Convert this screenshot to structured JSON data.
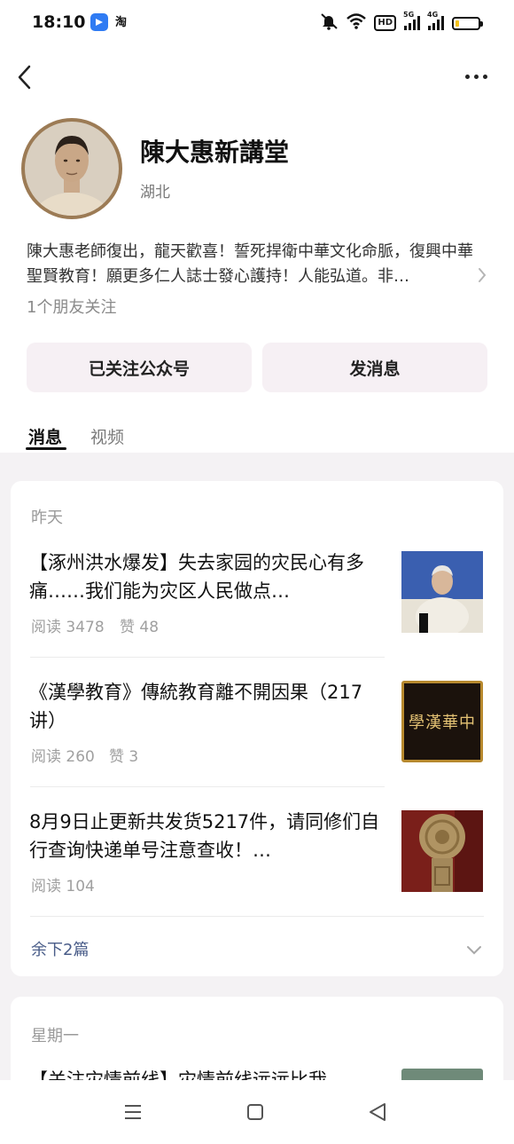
{
  "status_bar": {
    "time": "18:10",
    "app_icon_1": "tasks-icon",
    "app_icon_2_label": "淘",
    "hd_label": "HD",
    "signal_1_label": "5G",
    "signal_2_label": "4G"
  },
  "header": {
    "back_icon": "chevron-left-icon",
    "more_icon": "more-dots-icon"
  },
  "profile": {
    "name": "陳大惠新講堂",
    "region": "湖北",
    "bio": "陳大惠老師復出，龍天歡喜！誓死捍衛中華文化命脈，復興中華聖賢教育！願更多仁人誌士發心護持！人能弘道。非…",
    "friends_following": "1个朋友关注"
  },
  "actions": {
    "follow_label": "已关注公众号",
    "message_label": "发消息"
  },
  "tabs": [
    {
      "label": "消息",
      "active": true
    },
    {
      "label": "视频",
      "active": false
    }
  ],
  "feed": {
    "groups": [
      {
        "date": "昨天",
        "articles": [
          {
            "title": "【涿州洪水爆发】失去家园的灾民心有多痛……我们能为灾区人民做点…",
            "reads": "阅读 3478",
            "likes": "赞 48"
          },
          {
            "title": "《漢學教育》傳統教育離不開因果（217讲）",
            "reads": "阅读 260",
            "likes": "赞 3",
            "thumb_text": "學漢華中"
          },
          {
            "title": "8月9日止更新共发货5217件，请同修们自行查询快递单号注意查收！…",
            "reads": "阅读 104",
            "likes": ""
          }
        ],
        "remaining": "余下2篇"
      },
      {
        "date": "星期一",
        "articles": [
          {
            "title": "【关注灾情前线】灾情前线远远比我",
            "reads": "",
            "likes": ""
          }
        ]
      }
    ]
  },
  "colors": {
    "link": "#4a5d89",
    "feed_bg": "#f4f2f4",
    "button_bg": "#f6f0f4"
  }
}
